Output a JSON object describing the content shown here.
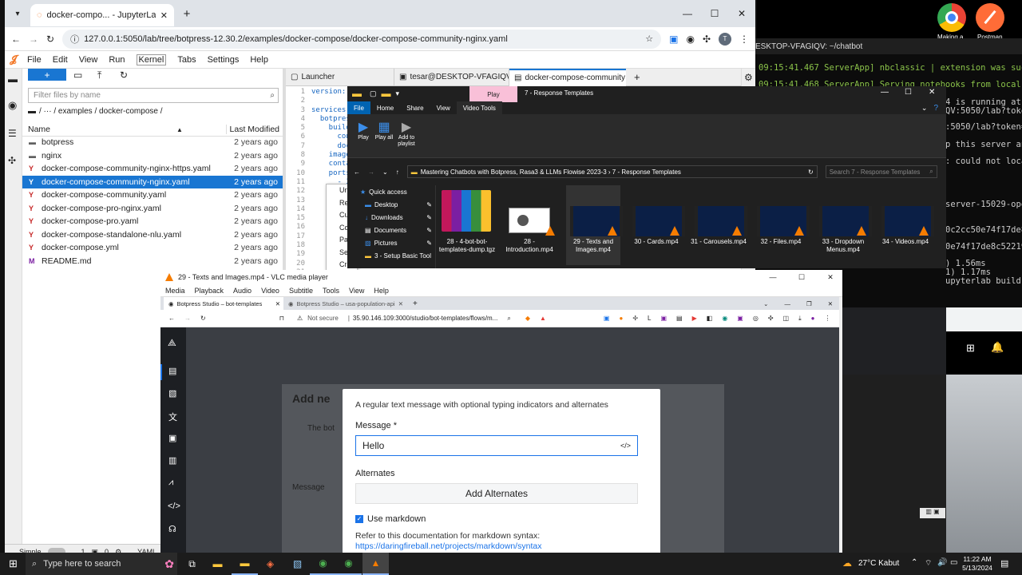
{
  "desktop": {
    "icons": [
      {
        "name": "Making a..."
      },
      {
        "name": "Postman"
      }
    ]
  },
  "terminal": {
    "title": "ESKTOP-VFAGIQV: ~/chatbot",
    "lines": [
      "09:15:41.467 ServerApp] nbclassic | extension was successfully",
      "09:15:41.468 ServerApp] Serving notebooks from local directory",
      "4 is running at:",
      "QV:5050/lab?token=",
      ":5050/lab?token=0b",
      "p this server and",
      ": could not locate",
      "server-15029-open.",
      "0c2cc50e74f17de8c5",
      "0e74f17de8c5221990",
      ") 1.56ms",
      "1) 1.17ms",
      "upyterlab build stat"
    ]
  },
  "jupyter": {
    "tab_title": "docker-compo... - JupyterLab",
    "url": "127.0.0.1:5050/lab/tree/botpress-12.30.2/examples/docker-compose/docker-compose-community-nginx.yaml",
    "menu": [
      "File",
      "Edit",
      "View",
      "Run",
      "Kernel",
      "Tabs",
      "Settings",
      "Help"
    ],
    "new_button": "+",
    "filter_placeholder": "Filter files by name",
    "breadcrumb": "/ ··· / examples / docker-compose /",
    "col_name": "Name",
    "col_modified": "Last Modified",
    "files": [
      {
        "name": "botpress",
        "type": "folder",
        "modified": "2 years ago"
      },
      {
        "name": "nginx",
        "type": "folder",
        "modified": "2 years ago"
      },
      {
        "name": "docker-compose-community-nginx-https.yaml",
        "type": "yaml",
        "modified": "2 years ago"
      },
      {
        "name": "docker-compose-community-nginx.yaml",
        "type": "yaml",
        "modified": "2 years ago",
        "selected": true
      },
      {
        "name": "docker-compose-community.yaml",
        "type": "yaml",
        "modified": "2 years ago"
      },
      {
        "name": "docker-compose-pro-nginx.yaml",
        "type": "yaml",
        "modified": "2 years ago"
      },
      {
        "name": "docker-compose-pro.yaml",
        "type": "yaml",
        "modified": "2 years ago"
      },
      {
        "name": "docker-compose-standalone-nlu.yaml",
        "type": "yaml",
        "modified": "2 years ago"
      },
      {
        "name": "docker-compose.yml",
        "type": "yaml",
        "modified": "2 years ago"
      },
      {
        "name": "README.md",
        "type": "md",
        "modified": "2 years ago"
      }
    ],
    "doc_tabs": [
      "Launcher",
      "tesar@DESKTOP-VFAGIQV: ~",
      "docker-compose-community"
    ],
    "code_lines": [
      "version: '",
      "",
      "services:",
      "  botpress",
      "    build:",
      "      cont",
      "      dock",
      "    image:",
      "    contai",
      "    ports:",
      "      - 30",
      "",
      "",
      "",
      "",
      "",
      "",
      "",
      "",
      "",
      ""
    ],
    "context_menu": [
      "Un",
      "Re",
      "Cu",
      "Co",
      "Pas",
      "Sel",
      "Cre"
    ],
    "status": {
      "mode": "Simple",
      "n1": "1",
      "n2": "0",
      "lang": "YAML"
    }
  },
  "explorer": {
    "title": "7 - Response Templates",
    "play_tab": "Play",
    "tabs": [
      "File",
      "Home",
      "Share",
      "View",
      "Video Tools"
    ],
    "ribbon": [
      "Play",
      "Play all",
      "Add to playlist"
    ],
    "path": "Mastering Chatbots with Botpress, Rasa3 & LLMs Flowise 2023-3  ›  7 - Response Templates",
    "search_placeholder": "Search 7 - Response Templates",
    "nav": [
      "Quick access",
      "Desktop",
      "Downloads",
      "Documents",
      "Pictures",
      "3 - Setup Basic Tool"
    ],
    "files": [
      "28 - 4-bot-bot-templates-dump.tgz",
      "28 - Introduction.mp4",
      "29 - Texts and Images.mp4",
      "30 - Cards.mp4",
      "31 - Carousels.mp4",
      "32 - Files.mp4",
      "33 - Dropdown Menus.mp4",
      "34 - Videos.mp4"
    ]
  },
  "vlc": {
    "title": "29 - Texts and Images.mp4 - VLC media player",
    "menu": [
      "Media",
      "Playback",
      "Audio",
      "Video",
      "Subtitle",
      "Tools",
      "View",
      "Help"
    ],
    "browser_tabs": [
      "Botpress Studio – bot-templates",
      "Botpress Studio – usa-population-api"
    ],
    "not_secure": "Not secure",
    "url": "35.90.146.109:3000/studio/bot-templates/flows/m...",
    "dialog": {
      "description": "A regular text message with optional typing indicators and alternates",
      "message_label": "Message *",
      "message_value": "Hello",
      "alternates_label": "Alternates",
      "add_alternates": "Add Alternates",
      "markdown_label": "Use markdown",
      "doc_text": "Refer to this documentation for markdown syntax:",
      "doc_link": "https://daringfireball.net/projects/markdown/syntax"
    },
    "bg_texts": {
      "add_new": "Add ne",
      "message": "Message",
      "the_bot": "The bot"
    }
  },
  "taskbar": {
    "search_placeholder": "Type here to search",
    "weather": "27°C  Kabut",
    "time": "11:22 AM",
    "date": "5/13/2024"
  }
}
